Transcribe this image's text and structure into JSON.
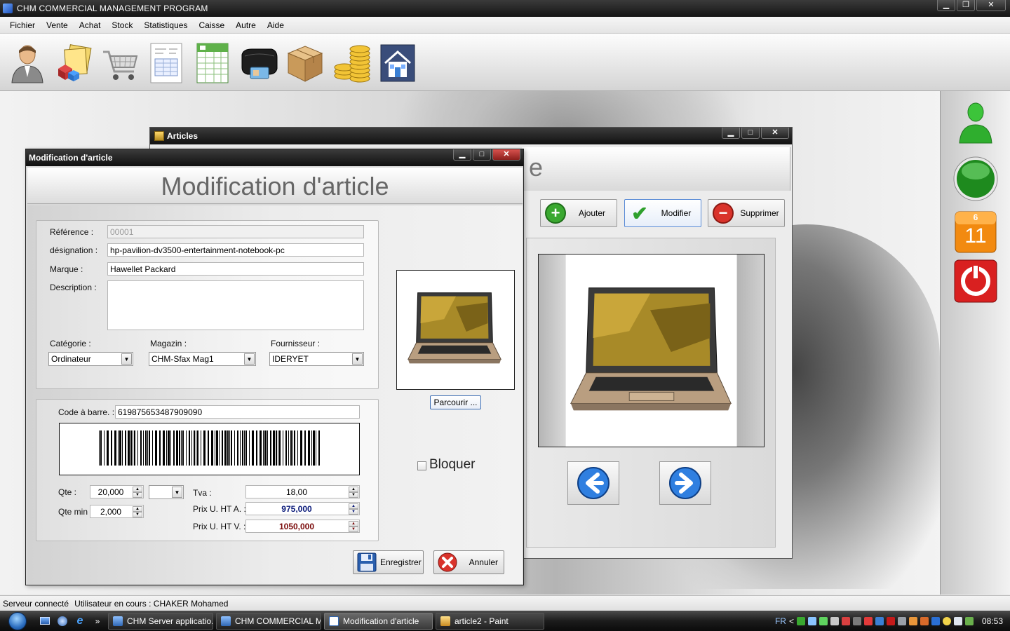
{
  "main_window": {
    "title": "CHM COMMERCIAL MANAGEMENT PROGRAM"
  },
  "window_buttons": {
    "minimize": "▁",
    "restore": "❐",
    "maximize": "□",
    "close": "✕"
  },
  "menu": [
    "Fichier",
    "Vente",
    "Achat",
    "Stock",
    "Statistiques",
    "Caisse",
    "Autre",
    "Aide"
  ],
  "toolbar_icons": [
    "user-icon",
    "products-icon",
    "cart-icon",
    "invoice-icon",
    "spreadsheet-icon",
    "wallet-icon",
    "box-icon",
    "coins-icon",
    "home-icon"
  ],
  "side_tools": {
    "calendar_month": "6",
    "calendar_day": "11"
  },
  "articles_window": {
    "title": "Articles",
    "header_fragment": "e",
    "buttons": {
      "add": "Ajouter",
      "edit": "Modifier",
      "delete": "Supprimer"
    }
  },
  "dialog": {
    "title": "Modification d'article",
    "header": "Modification d'article",
    "fields": {
      "reference_label": "Référence :",
      "reference_value": "00001",
      "designation_label": "désignation :",
      "designation_value": "hp-pavilion-dv3500-entertainment-notebook-pc",
      "brand_label": "Marque :",
      "brand_value": "Hawellet Packard",
      "description_label": "Description :",
      "category_label": "Catégorie :",
      "category_value": "Ordinateur",
      "store_label": "Magazin :",
      "store_value": "CHM-Sfax Mag1",
      "supplier_label": "Fournisseur :",
      "supplier_value": "IDERYET",
      "barcode_label": "Code à barre. :",
      "barcode_value": "619875653487909090",
      "qty_label": "Qte :",
      "qty_value": "20,000",
      "qty_min_label": "Qte min :",
      "qty_min_value": "2,000",
      "tva_label": "Tva :",
      "tva_value": "18,00",
      "buy_price_label": "Prix U. HT A. :",
      "buy_price_value": "975,000",
      "sell_price_label": "Prix U. HT V. :",
      "sell_price_value": "1050,000"
    },
    "browse_button": "Parcourir ...",
    "block_label": "Bloquer",
    "block_checked": false,
    "save_button": "Enregistrer",
    "cancel_button": "Annuler"
  },
  "statusbar": {
    "server": "Serveur connecté",
    "user": "Utilisateur en cours : CHAKER Mohamed"
  },
  "taskbar": {
    "quicklaunch_more": "»",
    "tasks": [
      "CHM Server applicatio...",
      "CHM COMMERCIAL M...",
      "Modification d'article",
      "article2 - Paint"
    ],
    "language": "FR",
    "tray_arrow": "<",
    "clock": "08:53"
  },
  "colors": {
    "titlebar": "#1a1a1a",
    "buy_price_text": "#0a1a7a",
    "sell_price_text": "#7a0a0a",
    "add_icon": "#3aa830",
    "delete_icon": "#d9332b",
    "power_button": "#d92020",
    "calendar": "#f28a10"
  }
}
